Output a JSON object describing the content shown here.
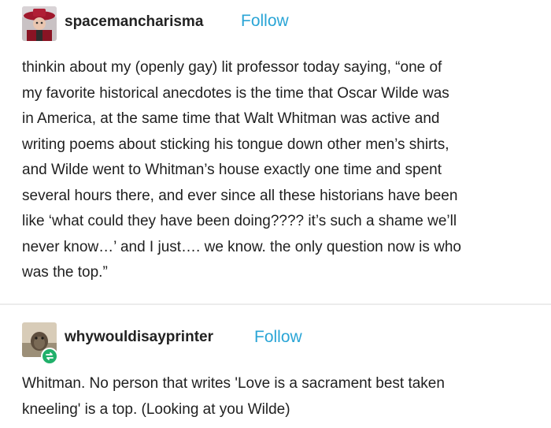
{
  "posts": [
    {
      "username": "spacemancharisma",
      "follow_label": "Follow",
      "avatar_icon": "avatar-icon",
      "text": "thinkin about my (openly gay) lit professor today saying, “one of\nmy favorite historical anecdotes is the time that Oscar Wilde was\nin America, at the same time that Walt Whitman was active and\nwriting poems about sticking his tongue down other men’s shirts,\nand Wilde went to Whitman’s house exactly one time and spent\nseveral hours there, and ever since all these historians have been\nlike ‘what could they have been doing???? it’s such a shame we’ll\nnever know…’ and I just…. we know. the only question now is who\nwas the top.”"
    },
    {
      "username": "whywouldisayprinter",
      "follow_label": "Follow",
      "avatar_icon": "avatar-icon",
      "reblog_icon": "reblog-icon",
      "text": "Whitman. No person that writes 'Love is a sacrament best taken\nkneeling' is a top. (Looking at you Wilde)"
    }
  ],
  "colors": {
    "follow": "#2aa5d6",
    "reblog_badge": "#20b06a",
    "divider": "#ececec"
  }
}
